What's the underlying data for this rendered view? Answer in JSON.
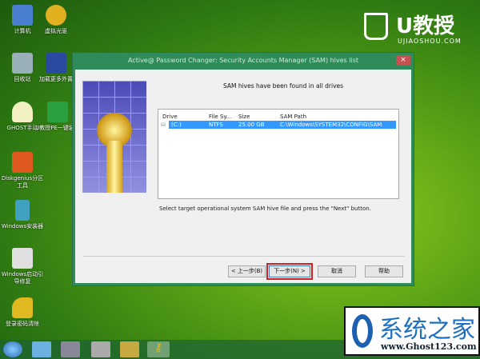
{
  "desktop_icons": [
    {
      "label": "计算机",
      "icon": "computer-icon",
      "color": "#4a7fd0"
    },
    {
      "label": "虚拟光驱",
      "icon": "disc-icon",
      "color": "#e0b020"
    },
    {
      "label": "回收站",
      "icon": "recycle-bin-icon",
      "color": "#9ab0b8"
    },
    {
      "label": "加载更多外置",
      "icon": "expand-icon",
      "color": "#2a4aa0"
    },
    {
      "label": "GHOST手动",
      "icon": "ghost-icon",
      "color": "#f0f0c0"
    },
    {
      "label": "U教授PE一键装机",
      "icon": "shield-icon",
      "color": "#2aa040"
    },
    {
      "label": "Diskgenius分区工具",
      "icon": "diskgenius-icon",
      "color": "#e05a20"
    },
    {
      "label": "Windows安装器",
      "icon": "installer-icon",
      "color": "#40a0c0"
    },
    {
      "label": "Windows启动引导修复",
      "icon": "boot-repair-icon",
      "color": "#e0e0e0"
    },
    {
      "label": "登录密码清除",
      "icon": "key-icon",
      "color": "#e0b820"
    }
  ],
  "brand": {
    "name": "U教授",
    "domain": "UJIAOSHOU.COM"
  },
  "watermark": {
    "name": "系统之家",
    "url": "www.Ghost123.com"
  },
  "dialog": {
    "title": "Active@ Password Changer: Security Accounts Manager (SAM) hives list",
    "close": "×",
    "heading": "SAM hives have been found in all drives",
    "columns": [
      "Drive",
      "File Sy...",
      "Size",
      "SAM Path"
    ],
    "rows": [
      {
        "drive": "(C:)",
        "fs": "NTFS",
        "size": "25.00 GB",
        "path": "C:\\Windows\\SYSTEM32\\CONFIG\\SAM",
        "selected": true
      }
    ],
    "instruction": "Select target operational system SAM hive file and press the \"Next\" button.",
    "buttons": {
      "back": "< 上一步(B)",
      "next": "下一步(N) >",
      "cancel": "取消",
      "help": "帮助"
    }
  },
  "taskbar": {
    "items": [
      "start-orb-icon",
      "monitor-icon",
      "printer-icon",
      "drive-icon",
      "tool-icon",
      "key-icon"
    ]
  }
}
